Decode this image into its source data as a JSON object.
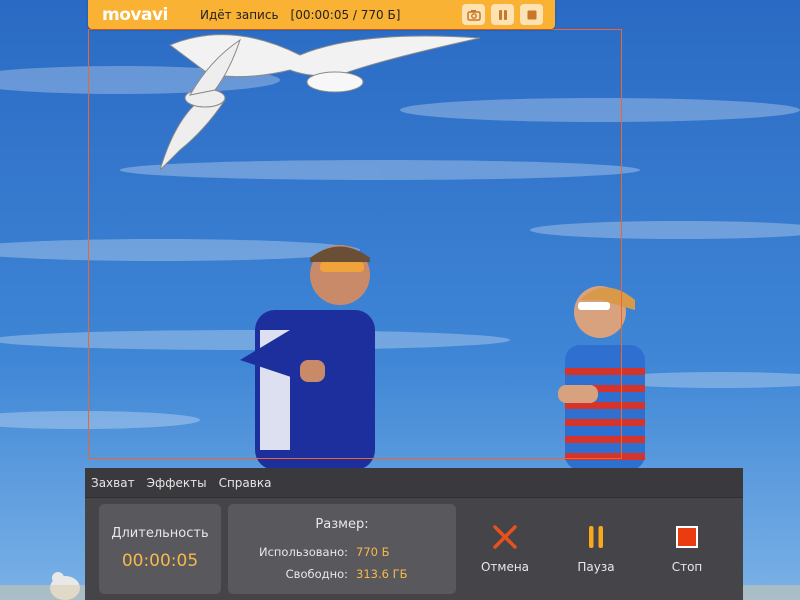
{
  "recorder": {
    "logo": "movavi",
    "status": "Идёт запись",
    "timer": "[00:00:05 / 770 Б]",
    "buttons": {
      "screenshot": "camera-icon",
      "pause": "pause-icon",
      "stop": "stop-icon"
    }
  },
  "menu": {
    "items": [
      "Захват",
      "Эффекты",
      "Справка"
    ]
  },
  "duration": {
    "label": "Длительность",
    "value": "00:00:05"
  },
  "size": {
    "label": "Размер:",
    "used_label": "Использовано:",
    "used_value": "770 Б",
    "free_label": "Свободно:",
    "free_value": "313.6 ГБ"
  },
  "actions": {
    "cancel": "Отмена",
    "pause": "Пауза",
    "stop": "Стоп"
  },
  "colors": {
    "accent": "#f9b233",
    "value_text": "#f7b94b",
    "cancel": "#e8501e",
    "stop": "#ea3c0f",
    "frame": "#f0662a",
    "panel": "#454549"
  }
}
